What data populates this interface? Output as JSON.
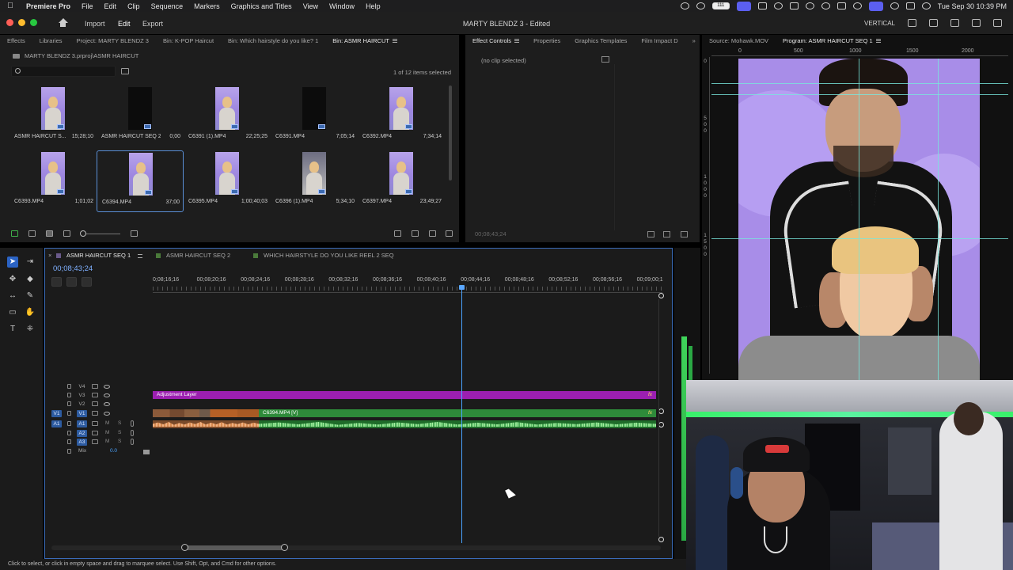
{
  "menubar": {
    "app": "Premiere Pro",
    "items": [
      "File",
      "Edit",
      "Clip",
      "Sequence",
      "Markers",
      "Graphics and Titles",
      "View",
      "Window",
      "Help"
    ],
    "battery": "111",
    "clock": "Tue Sep 30  10:39 PM"
  },
  "header": {
    "workspace_tabs": [
      "Import",
      "Edit",
      "Export"
    ],
    "active_tab": "Edit",
    "doc_title": "MARTY BLENDZ 3 - Edited",
    "mode_label": "VERTICAL"
  },
  "project_panel": {
    "tabs": [
      "Effects",
      "Libraries",
      "Project: MARTY BLENDZ 3",
      "Bin: K-POP Haircut",
      "Bin: Which hairstyle do you like? 1",
      "Bin: ASMR HAIRCUT"
    ],
    "active_tab": "Bin: ASMR HAIRCUT",
    "path": "MARTY BLENDZ 3.prproj\\ASMR HAIRCUT",
    "search_placeholder": "",
    "selection_count": "1 of 12 items selected",
    "clips": [
      {
        "name": "ASMR HAIRCUT S...",
        "duration": "15;28;10",
        "thumb": "purple"
      },
      {
        "name": "ASMR HAIRCUT SEQ 2",
        "duration": "0;00",
        "thumb": "dark"
      },
      {
        "name": "C6391 (1).MP4",
        "duration": "22;25;25",
        "thumb": "purple"
      },
      {
        "name": "C6391.MP4",
        "duration": "7;05;14",
        "thumb": "dark"
      },
      {
        "name": "C6392.MP4",
        "duration": "7;34;14",
        "thumb": "purple"
      },
      {
        "name": "C6393.MP4",
        "duration": "1;01;02",
        "thumb": "purple"
      },
      {
        "name": "C6394.MP4",
        "duration": "37;00",
        "thumb": "purple",
        "selected": true
      },
      {
        "name": "C6395.MP4",
        "duration": "1;00;40;03",
        "thumb": "purple"
      },
      {
        "name": "C6396 (1).MP4",
        "duration": "5;34;10",
        "thumb": "gray"
      },
      {
        "name": "C6397.MP4",
        "duration": "23;49;27",
        "thumb": "purple"
      }
    ]
  },
  "effect_controls": {
    "tabs": [
      "Effect Controls",
      "Properties",
      "Graphics Templates",
      "Film Impact D"
    ],
    "active_tab": "Effect Controls",
    "no_clip": "(no clip selected)",
    "timecode": "00;08;43;24"
  },
  "program_monitor": {
    "tabs": [
      "Source: Mohawk.MOV",
      "Program: ASMR HAIRCUT SEQ 1"
    ],
    "active_tab": "Program: ASMR HAIRCUT SEQ 1",
    "ruler_h": [
      "0",
      "500",
      "1000",
      "1500",
      "2000"
    ],
    "ruler_v": [
      "0",
      "5\n0\n0",
      "1\n0\n0\n0",
      "1\n5\n0\n0"
    ]
  },
  "timeline": {
    "tabs": [
      {
        "label": "ASMR HAIRCUT SEQ 1",
        "color": "#6a5a8a"
      },
      {
        "label": "ASMR HAIRCUT SEQ 2",
        "color": "#4a7a3a"
      },
      {
        "label": "WHICH HAIRSTYLE DO YOU LIKE REEL 2 SEQ",
        "color": "#4a7a3a"
      }
    ],
    "timecode": "00;08;43;24",
    "ruler_ticks": [
      "0;08;16;16",
      "00;08;20;16",
      "00;08;24;16",
      "00;08;28;16",
      "00;08;32;16",
      "00;08;36;16",
      "00;08;40;16",
      "00;08;44;16",
      "00;08;48;16",
      "00;08;52;16",
      "00;08;56;16",
      "00;09;00;1"
    ],
    "video_tracks": [
      "V4",
      "V3",
      "V2",
      "V1"
    ],
    "audio_tracks": [
      "A1",
      "A2",
      "A3"
    ],
    "track_targets": {
      "v": "V1",
      "a": "A1"
    },
    "mute": "M",
    "solo": "S",
    "mix_label": "Mix",
    "mix_value": "0.0",
    "adjustment_label": "Adjustment Layer",
    "main_clip_label": "C6394.MP4 [V]",
    "fx": "fx"
  },
  "status_bar": "Click to select, or click in empty space and drag to marquee select. Use Shift, Opt, and Cmd for other options."
}
